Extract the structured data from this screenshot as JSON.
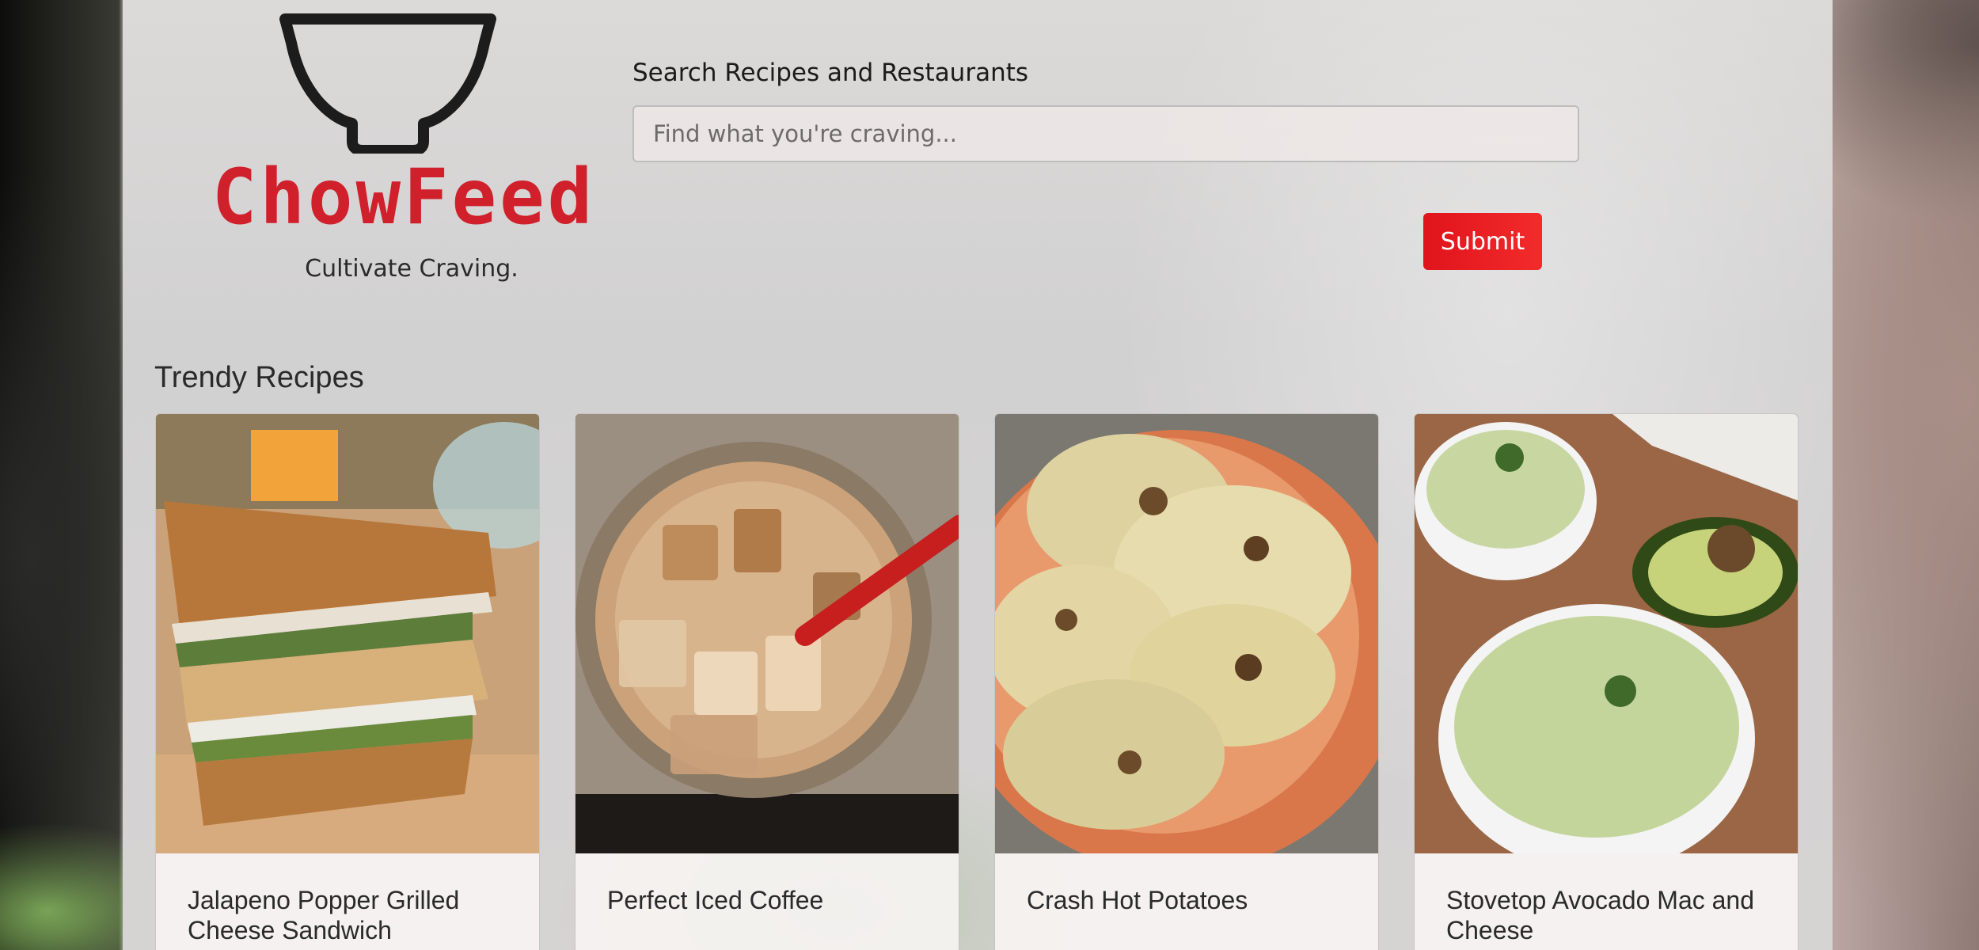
{
  "brand": {
    "name": "ChowFeed",
    "tagline": "Cultivate Craving.",
    "accent_color": "#d0202b"
  },
  "search": {
    "label": "Search Recipes and Restaurants",
    "placeholder": "Find what you're craving...",
    "value": "",
    "submit_label": "Submit",
    "submit_color": "#e8191f"
  },
  "trending": {
    "title": "Trendy Recipes",
    "recipes": [
      {
        "title": "Jalapeno Popper Grilled Cheese Sandwich",
        "image": "grilled-cheese-photo"
      },
      {
        "title": "Perfect Iced Coffee",
        "image": "iced-coffee-photo"
      },
      {
        "title": "Crash Hot Potatoes",
        "image": "smashed-potatoes-photo"
      },
      {
        "title": "Stovetop Avocado Mac and Cheese",
        "image": "avocado-mac-photo"
      }
    ]
  }
}
